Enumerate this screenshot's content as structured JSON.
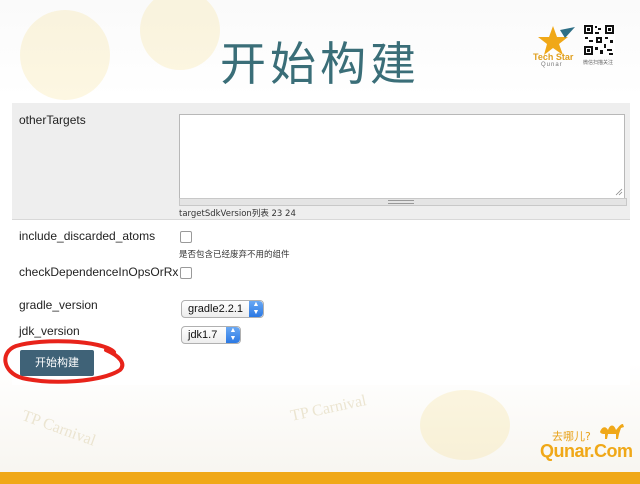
{
  "slide": {
    "title": "开始构建",
    "brand": {
      "logo_name": "Tech Star",
      "logo_sub": "Qunar",
      "qr_caption": "微信扫描关注",
      "footer_top": "去哪儿?",
      "footer_main": "Qunar.Com",
      "watermark": "TP Carnival"
    },
    "accent_color": "#f0a818",
    "title_color": "#3a6e78"
  },
  "form": {
    "other_targets": {
      "label": "otherTargets",
      "value": "",
      "hint": "targetSdkVersion列表 23 24"
    },
    "include_discarded_atoms": {
      "label": "include_discarded_atoms",
      "checked": false,
      "hint": "是否包含已经废弃不用的组件"
    },
    "check_dependence": {
      "label": "checkDependenceInOpsOrRx",
      "checked": false
    },
    "gradle_version": {
      "label": "gradle_version",
      "selected": "gradle2.2.1"
    },
    "jdk_version": {
      "label": "jdk_version",
      "selected": "jdk1.7"
    },
    "build_button": "开始构建"
  }
}
